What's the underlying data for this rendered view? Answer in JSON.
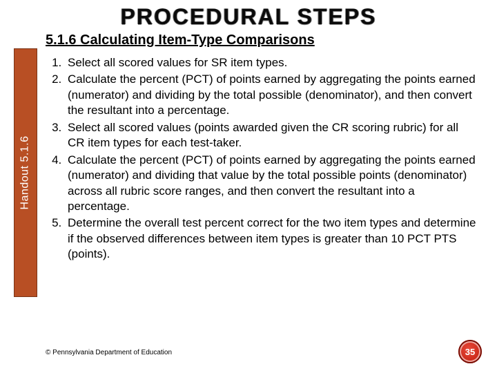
{
  "title": "PROCEDURAL STEPS",
  "sidebar_label": "Handout 5.1.6",
  "section_heading": "5.1.6 Calculating Item-Type Comparisons",
  "steps": [
    "Select all scored values for SR item types.",
    "Calculate the percent (PCT) of points earned by aggregating the points earned (numerator) and dividing by the total possible (denominator), and then convert the resultant into a percentage.",
    "Select all scored values (points awarded given the CR scoring rubric) for all CR item types for each test-taker.",
    "Calculate the percent (PCT) of points earned by aggregating the points earned (numerator) and dividing that value by the total possible points (denominator) across all rubric score ranges, and then convert the resultant into a percentage.",
    "Determine the overall test percent correct for the two item types and determine if the observed differences between item types is greater than 10 PCT PTS (points)."
  ],
  "copyright": "© Pennsylvania Department of Education",
  "slide_number": "35"
}
